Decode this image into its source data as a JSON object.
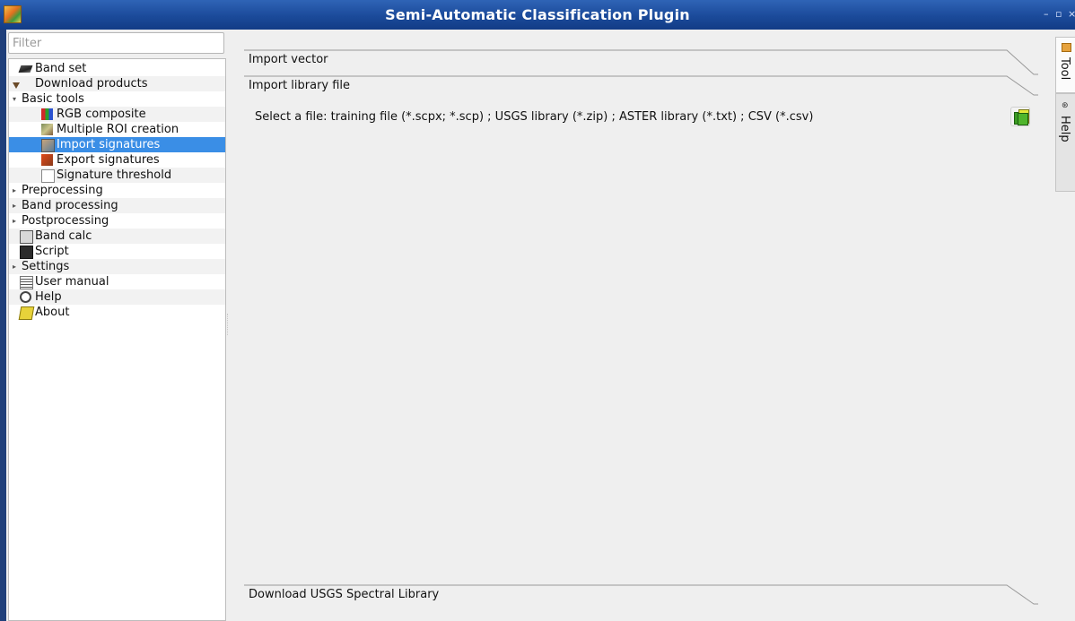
{
  "window": {
    "title": "Semi-Automatic Classification Plugin",
    "controls": [
      "–",
      "▫",
      "×"
    ]
  },
  "sidebar": {
    "filter_placeholder": "Filter",
    "items": [
      {
        "label": "Band set",
        "icon": "band-set-icon",
        "level": 1,
        "expander": ""
      },
      {
        "label": "Download products",
        "icon": "download-icon",
        "level": 1,
        "expander": ""
      },
      {
        "label": "Basic tools",
        "icon": "",
        "level": 0,
        "expander": "▾"
      },
      {
        "label": "RGB composite",
        "icon": "rgb-composite-icon",
        "level": 2,
        "expander": ""
      },
      {
        "label": "Multiple ROI creation",
        "icon": "multiple-roi-icon",
        "level": 2,
        "expander": ""
      },
      {
        "label": "Import signatures",
        "icon": "import-signatures-icon",
        "level": 2,
        "expander": "",
        "selected": true
      },
      {
        "label": "Export signatures",
        "icon": "export-signatures-icon",
        "level": 2,
        "expander": ""
      },
      {
        "label": "Signature threshold",
        "icon": "signature-threshold-icon",
        "level": 2,
        "expander": ""
      },
      {
        "label": "Preprocessing",
        "icon": "",
        "level": 0,
        "expander": "▸"
      },
      {
        "label": "Band processing",
        "icon": "",
        "level": 0,
        "expander": "▸"
      },
      {
        "label": "Postprocessing",
        "icon": "",
        "level": 0,
        "expander": "▸"
      },
      {
        "label": "Band calc",
        "icon": "band-calc-icon",
        "level": 1,
        "expander": ""
      },
      {
        "label": "Script",
        "icon": "script-icon",
        "level": 1,
        "expander": ""
      },
      {
        "label": "Settings",
        "icon": "",
        "level": 0,
        "expander": "▸"
      },
      {
        "label": "User manual",
        "icon": "user-manual-icon",
        "level": 1,
        "expander": ""
      },
      {
        "label": "Help",
        "icon": "help-icon",
        "level": 1,
        "expander": ""
      },
      {
        "label": "About",
        "icon": "about-icon",
        "level": 1,
        "expander": ""
      }
    ]
  },
  "main": {
    "sections": {
      "import_vector": "Import vector",
      "import_library_file": "Import library file",
      "download_usgs": "Download USGS Spectral Library"
    },
    "select_file_text": "Select a file: training file (*.scpx; *.scp) ; USGS library (*.zip) ; ASTER library (*.txt) ; CSV (*.csv)",
    "open_file_icon": "open-file-icon"
  },
  "right_tabs": {
    "tool": "Tool",
    "help": "Help"
  },
  "colors": {
    "titlebar": "#1b4a9a",
    "selection": "#3a8ee6",
    "panel_bg": "#efefef"
  }
}
